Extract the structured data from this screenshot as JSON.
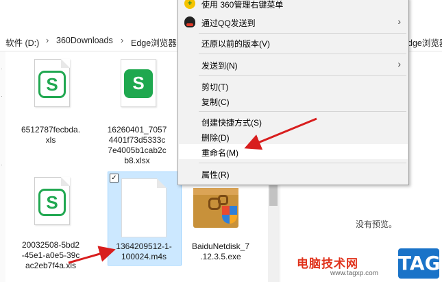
{
  "breadcrumb": {
    "items": [
      "软件 (D:)",
      "360Downloads",
      "Edge浏览器"
    ],
    "right_fragment": "dge浏览器"
  },
  "files": [
    {
      "name": "6512787fecbda.xls",
      "lines": [
        "6512787fecbda.",
        "xls"
      ],
      "icon": "wps-spreadsheet-outline-icon"
    },
    {
      "name": "16260401_70574401f73d5333c7e4005b1cab2cb8.xlsx",
      "lines": [
        "16260401_7057",
        "4401f73d5333c",
        "7e4005b1cab2c",
        "b8.xlsx"
      ],
      "icon": "wps-spreadsheet-filled-icon"
    },
    {
      "name": "20032508-5bd2-45e1-a0e5-39cac2eb7f4a.xls",
      "lines": [
        "20032508-5bd2",
        "-45e1-a0e5-39c",
        "ac2eb7f4a.xls"
      ],
      "icon": "wps-spreadsheet-outline-icon"
    },
    {
      "name": "1364209512-1-100024.m4s",
      "lines": [
        "1364209512-1-",
        "100024.m4s"
      ],
      "icon": "blank-file-icon",
      "selected": true
    },
    {
      "name": "BaiduNetdisk_7.12.3.5.exe",
      "lines": [
        "BaiduNetdisk_7",
        ".12.3.5.exe"
      ],
      "icon": "installer-box-icon"
    }
  ],
  "context_menu": {
    "items": [
      {
        "label": "使用 360管理右键菜单",
        "icon": "360-icon"
      },
      {
        "label": "通过QQ发送到",
        "icon": "qq-icon",
        "submenu": true
      },
      {
        "label": "还原以前的版本(V)"
      },
      {
        "label": "发送到(N)",
        "submenu": true
      },
      {
        "label": "剪切(T)"
      },
      {
        "label": "复制(C)"
      },
      {
        "label": "创建快捷方式(S)"
      },
      {
        "label": "删除(D)"
      },
      {
        "label": "重命名(M)",
        "highlighted": true
      },
      {
        "label": "属性(R)"
      }
    ]
  },
  "preview": {
    "empty_text": "没有预览。"
  },
  "watermark": {
    "site_name": "电脑技术网",
    "url": "www.tagxp.com",
    "tag": "TAG"
  },
  "colors": {
    "selection": "#cce8ff",
    "wps_green": "#1fa84f",
    "arrow_red": "#d81e1e",
    "tag_blue": "#1a73c8"
  }
}
